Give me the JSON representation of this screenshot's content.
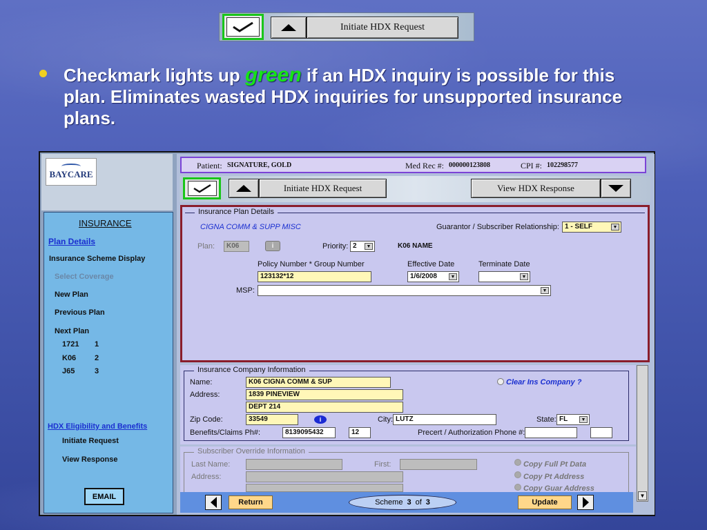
{
  "top_toolbar": {
    "initiate_label": "Initiate  HDX  Request"
  },
  "bullet": {
    "text_before": "Checkmark lights up ",
    "green_word": "green",
    "text_after": " if an HDX inquiry is possible for this plan.  Eliminates wasted HDX inquiries for unsupported insurance plans."
  },
  "app": {
    "logo_text": "BAYCARE",
    "sidebar": {
      "section_title": "INSURANCE",
      "plan_details": "Plan Details",
      "scheme_display": "Insurance Scheme Display",
      "select_coverage": "Select Coverage",
      "new_plan": "New Plan",
      "previous_plan": "Previous Plan",
      "next_plan": "Next Plan",
      "next_plans": [
        {
          "code": "1721",
          "num": "1"
        },
        {
          "code": "K06",
          "num": "2"
        },
        {
          "code": "J65",
          "num": "3"
        }
      ],
      "hdx_link": "HDX Eligibility and Benefits",
      "initiate_request": "Initiate Request",
      "view_response": "View Response",
      "email": "EMAIL"
    },
    "patient_bar": {
      "patient_label": "Patient:",
      "patient_value": "SIGNATURE,  GOLD",
      "medrec_label": "Med Rec #:",
      "medrec_value": "000000123808",
      "cpi_label": "CPI #:",
      "cpi_value": "102298577"
    },
    "toolbar": {
      "initiate_label": "Initiate  HDX  Request",
      "view_label": "View  HDX  Response"
    },
    "plan_details": {
      "legend": "Insurance Plan Details",
      "plan_name": "CIGNA COMM & SUPP MISC",
      "guarantor_label": "Guarantor / Subscriber Relationship:",
      "guarantor_value": "1 - SELF",
      "plan_label": "Plan:",
      "plan_value": "K06",
      "priority_label": "Priority:",
      "priority_value": "2",
      "plan_code_name": "K06 NAME",
      "policy_label": "Policy Number * Group Number",
      "policy_value": "123132*12",
      "effective_label": "Effective Date",
      "effective_value": "1/6/2008",
      "terminate_label": "Terminate Date",
      "terminate_value": "",
      "msp_label": "MSP:",
      "msp_value": ""
    },
    "company_info": {
      "legend": "Insurance Company Information",
      "name_label": "Name:",
      "name_value": "K06 CIGNA COMM & SUP",
      "clear_label": "Clear Ins Company ?",
      "address_label": "Address:",
      "address1": "1839 PINEVIEW",
      "address2": "DEPT 214",
      "zip_label": "Zip Code:",
      "zip_value": "33549",
      "city_label": "City:",
      "city_value": "LUTZ",
      "state_label": "State:",
      "state_value": "FL",
      "phone_label": "Benefits/Claims Ph#:",
      "phone_value": "8139095432",
      "phone_ext": "12",
      "precert_label": "Precert / Authorization Phone #:",
      "precert_value": "",
      "precert_ext": ""
    },
    "subscriber": {
      "legend": "Subscriber Override Information",
      "last_name_label": "Last Name:",
      "first_label": "First:",
      "address_label": "Address:",
      "copy_full": "Copy Full Pt Data",
      "copy_address": "Copy Pt Address",
      "copy_guar": "Copy Guar Address"
    },
    "bottom": {
      "return_label": "Return",
      "scheme_label": "Scheme",
      "scheme_current": "3",
      "scheme_of": "of",
      "scheme_total": "3",
      "update_label": "Update"
    }
  }
}
